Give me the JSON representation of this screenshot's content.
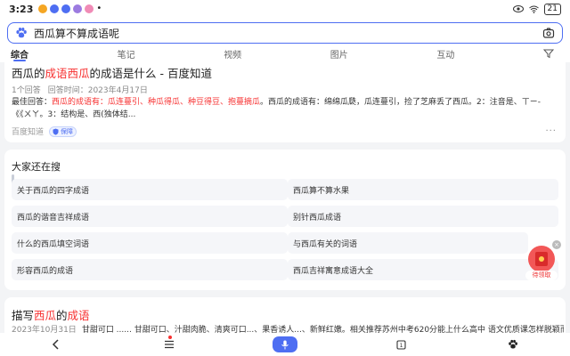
{
  "status": {
    "time": "3:23",
    "battery": "21"
  },
  "search": {
    "query": "西瓜算不算成语呢"
  },
  "tabs": [
    "综合",
    "笔记",
    "视频",
    "图片",
    "互动"
  ],
  "result1": {
    "title_parts": [
      "西瓜的",
      "成语",
      "西瓜",
      "的成语是什么 - 百度知道"
    ],
    "meta_answers": "1个回答",
    "meta_time": "回答时间：2023年4月17日",
    "body_label": "最佳回答：",
    "body_red": "西瓜的成语有：瓜连蔓引、种瓜得瓜、种豆得豆、抱蔓摘瓜",
    "body_rest": "。西瓜的成语有：绵绵瓜瓞，瓜连蔓引，捡了芝麻丢了西瓜。2：注音是、ㄒㄧ-《《ㄨㄚ。3：结构是、西(独体结...",
    "source": "百度知道",
    "badge": "保障",
    "more": "···"
  },
  "related": {
    "title": "大家还在搜",
    "items": [
      "关于西瓜的四字成语",
      "西瓜算不算水果",
      "西瓜的谐音吉祥成语",
      "别针西瓜成语",
      "什么的西瓜填空词语",
      "与西瓜有关的词语",
      "形容西瓜的成语",
      "西瓜吉祥寓意成语大全"
    ]
  },
  "redpacket": {
    "label": "待领取",
    "close": "×"
  },
  "result3": {
    "title_parts": [
      "描写",
      "西瓜",
      "的",
      "成语"
    ],
    "date": "2023年10月31日",
    "body": "甘甜可口 ...... 甘甜可口、汁甜肉脆、清爽可口...、果香诱人...、新鲜红嫩。相关推荐苏州中考620分能上什么高中 语文优质课怎样脱颖而出"
  },
  "colors": {
    "accent": "#4e6ef2",
    "highlight": "#f73131"
  }
}
